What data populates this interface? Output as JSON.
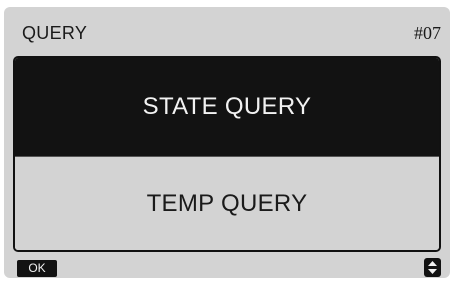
{
  "header": {
    "title": "QUERY",
    "code": "#07"
  },
  "menu": {
    "items": [
      {
        "label": "STATE QUERY",
        "selected": true
      },
      {
        "label": "TEMP QUERY",
        "selected": false
      }
    ]
  },
  "footer": {
    "ok_label": "OK",
    "scroll_icon": "up-down-arrows-icon"
  },
  "colors": {
    "screen_background": "#d3d3d3",
    "selected_background": "#121212",
    "selected_text": "#f2f2f2",
    "text": "#1a1a1a"
  }
}
